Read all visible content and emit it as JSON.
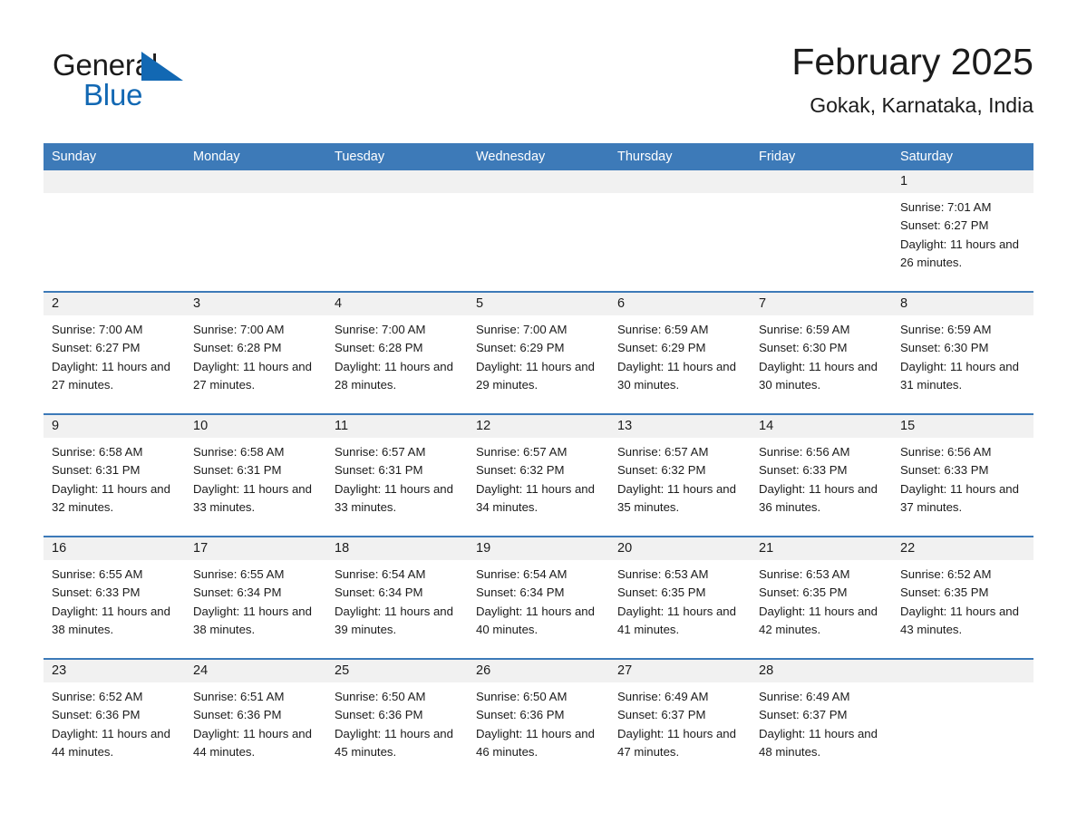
{
  "brand": {
    "name_part1": "General",
    "name_part2": "Blue",
    "triangle_icon": "triangle-logo-icon",
    "accent_color": "#1268b3"
  },
  "header": {
    "title": "February 2025",
    "location": "Gokak, Karnataka, India"
  },
  "calendar": {
    "header_color": "#3d7ab8",
    "date_band_color": "#f1f1f1",
    "weekdays": [
      "Sunday",
      "Monday",
      "Tuesday",
      "Wednesday",
      "Thursday",
      "Friday",
      "Saturday"
    ],
    "weeks": [
      [
        {
          "date": "",
          "empty": true
        },
        {
          "date": "",
          "empty": true
        },
        {
          "date": "",
          "empty": true
        },
        {
          "date": "",
          "empty": true
        },
        {
          "date": "",
          "empty": true
        },
        {
          "date": "",
          "empty": true
        },
        {
          "date": "1",
          "sunrise": "Sunrise: 7:01 AM",
          "sunset": "Sunset: 6:27 PM",
          "daylight": "Daylight: 11 hours and 26 minutes."
        }
      ],
      [
        {
          "date": "2",
          "sunrise": "Sunrise: 7:00 AM",
          "sunset": "Sunset: 6:27 PM",
          "daylight": "Daylight: 11 hours and 27 minutes."
        },
        {
          "date": "3",
          "sunrise": "Sunrise: 7:00 AM",
          "sunset": "Sunset: 6:28 PM",
          "daylight": "Daylight: 11 hours and 27 minutes."
        },
        {
          "date": "4",
          "sunrise": "Sunrise: 7:00 AM",
          "sunset": "Sunset: 6:28 PM",
          "daylight": "Daylight: 11 hours and 28 minutes."
        },
        {
          "date": "5",
          "sunrise": "Sunrise: 7:00 AM",
          "sunset": "Sunset: 6:29 PM",
          "daylight": "Daylight: 11 hours and 29 minutes."
        },
        {
          "date": "6",
          "sunrise": "Sunrise: 6:59 AM",
          "sunset": "Sunset: 6:29 PM",
          "daylight": "Daylight: 11 hours and 30 minutes."
        },
        {
          "date": "7",
          "sunrise": "Sunrise: 6:59 AM",
          "sunset": "Sunset: 6:30 PM",
          "daylight": "Daylight: 11 hours and 30 minutes."
        },
        {
          "date": "8",
          "sunrise": "Sunrise: 6:59 AM",
          "sunset": "Sunset: 6:30 PM",
          "daylight": "Daylight: 11 hours and 31 minutes."
        }
      ],
      [
        {
          "date": "9",
          "sunrise": "Sunrise: 6:58 AM",
          "sunset": "Sunset: 6:31 PM",
          "daylight": "Daylight: 11 hours and 32 minutes."
        },
        {
          "date": "10",
          "sunrise": "Sunrise: 6:58 AM",
          "sunset": "Sunset: 6:31 PM",
          "daylight": "Daylight: 11 hours and 33 minutes."
        },
        {
          "date": "11",
          "sunrise": "Sunrise: 6:57 AM",
          "sunset": "Sunset: 6:31 PM",
          "daylight": "Daylight: 11 hours and 33 minutes."
        },
        {
          "date": "12",
          "sunrise": "Sunrise: 6:57 AM",
          "sunset": "Sunset: 6:32 PM",
          "daylight": "Daylight: 11 hours and 34 minutes."
        },
        {
          "date": "13",
          "sunrise": "Sunrise: 6:57 AM",
          "sunset": "Sunset: 6:32 PM",
          "daylight": "Daylight: 11 hours and 35 minutes."
        },
        {
          "date": "14",
          "sunrise": "Sunrise: 6:56 AM",
          "sunset": "Sunset: 6:33 PM",
          "daylight": "Daylight: 11 hours and 36 minutes."
        },
        {
          "date": "15",
          "sunrise": "Sunrise: 6:56 AM",
          "sunset": "Sunset: 6:33 PM",
          "daylight": "Daylight: 11 hours and 37 minutes."
        }
      ],
      [
        {
          "date": "16",
          "sunrise": "Sunrise: 6:55 AM",
          "sunset": "Sunset: 6:33 PM",
          "daylight": "Daylight: 11 hours and 38 minutes."
        },
        {
          "date": "17",
          "sunrise": "Sunrise: 6:55 AM",
          "sunset": "Sunset: 6:34 PM",
          "daylight": "Daylight: 11 hours and 38 minutes."
        },
        {
          "date": "18",
          "sunrise": "Sunrise: 6:54 AM",
          "sunset": "Sunset: 6:34 PM",
          "daylight": "Daylight: 11 hours and 39 minutes."
        },
        {
          "date": "19",
          "sunrise": "Sunrise: 6:54 AM",
          "sunset": "Sunset: 6:34 PM",
          "daylight": "Daylight: 11 hours and 40 minutes."
        },
        {
          "date": "20",
          "sunrise": "Sunrise: 6:53 AM",
          "sunset": "Sunset: 6:35 PM",
          "daylight": "Daylight: 11 hours and 41 minutes."
        },
        {
          "date": "21",
          "sunrise": "Sunrise: 6:53 AM",
          "sunset": "Sunset: 6:35 PM",
          "daylight": "Daylight: 11 hours and 42 minutes."
        },
        {
          "date": "22",
          "sunrise": "Sunrise: 6:52 AM",
          "sunset": "Sunset: 6:35 PM",
          "daylight": "Daylight: 11 hours and 43 minutes."
        }
      ],
      [
        {
          "date": "23",
          "sunrise": "Sunrise: 6:52 AM",
          "sunset": "Sunset: 6:36 PM",
          "daylight": "Daylight: 11 hours and 44 minutes."
        },
        {
          "date": "24",
          "sunrise": "Sunrise: 6:51 AM",
          "sunset": "Sunset: 6:36 PM",
          "daylight": "Daylight: 11 hours and 44 minutes."
        },
        {
          "date": "25",
          "sunrise": "Sunrise: 6:50 AM",
          "sunset": "Sunset: 6:36 PM",
          "daylight": "Daylight: 11 hours and 45 minutes."
        },
        {
          "date": "26",
          "sunrise": "Sunrise: 6:50 AM",
          "sunset": "Sunset: 6:36 PM",
          "daylight": "Daylight: 11 hours and 46 minutes."
        },
        {
          "date": "27",
          "sunrise": "Sunrise: 6:49 AM",
          "sunset": "Sunset: 6:37 PM",
          "daylight": "Daylight: 11 hours and 47 minutes."
        },
        {
          "date": "28",
          "sunrise": "Sunrise: 6:49 AM",
          "sunset": "Sunset: 6:37 PM",
          "daylight": "Daylight: 11 hours and 48 minutes."
        },
        {
          "date": "",
          "empty": true
        }
      ]
    ]
  }
}
